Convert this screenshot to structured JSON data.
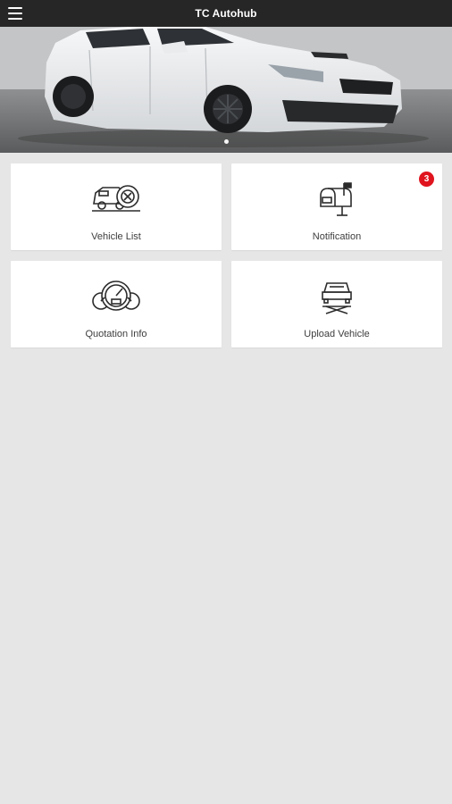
{
  "app_bar": {
    "title": "TC Autohub",
    "menu_icon": "hamburger-menu-icon",
    "background": "#262626"
  },
  "banner": {
    "image": "white-sedan-photo",
    "slide_count": 1,
    "active_slide": 1
  },
  "tiles": [
    {
      "label": "Vehicle List",
      "icon": "car-dashboard-icon"
    },
    {
      "label": "Notification",
      "icon": "mailbox-icon",
      "badge": "3",
      "badge_color": "#e0141e"
    },
    {
      "label": "Quotation Info",
      "icon": "speedometer-gauges-icon"
    },
    {
      "label": "Upload Vehicle",
      "icon": "car-on-jack-icon"
    }
  ],
  "colors": {
    "page_background": "#e6e6e6",
    "tile_background": "#ffffff",
    "label_text": "#3d3d3d"
  }
}
